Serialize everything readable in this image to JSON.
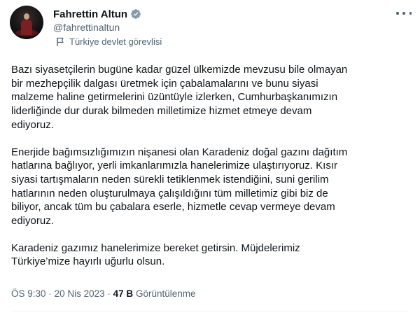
{
  "author": {
    "display_name": "Fahrettin Altun",
    "handle": "@fahrettinaltun",
    "verified_icon": "verified-badge-icon",
    "label": "Türkiye devlet görevlisi",
    "label_icon": "flag-icon",
    "verified_color": "#829aab"
  },
  "tweet": {
    "paragraphs": [
      "Bazı siyasetçilerin bugüne kadar güzel ülkemizde mevzusu bile olmayan\nbir mezhepçilik dalgası üretmek için çabalamalarını ve bunu siyasi\nmalzeme haline getirmelerini üzüntüyle izlerken, Cumhurbaşkanımızın\nliderliğinde dur durak bilmeden milletimize hizmet etmeye devam\nediyoruz.",
      "Enerjide bağımsızlığımızın nişanesi olan Karadeniz doğal gazını dağıtım\nhatlarına bağlıyor, yerli imkanlarımızla hanelerimize ulaştırıyoruz. Kısır\nsiyasi tartışmaların neden sürekli tetiklenmek istendiğini, suni gerilim\nhatlarının neden oluşturulmaya çalışıldığını tüm milletimiz gibi biz de\nbiliyor, ancak tüm bu çabalara eserle, hizmetle cevap vermeye devam\nediyoruz.",
      "Karadeniz gazımız hanelerimize bereket getirsin. Müjdelerimiz\nTürkiye’mize hayırlı uğurlu olsun."
    ],
    "time": "ÖS 9:30",
    "date": "20 Nis 2023",
    "separator": "·",
    "views_count": "47 B",
    "views_label": "Görüntülenme"
  },
  "actions": {
    "more_icon": "more-horizontal-icon"
  }
}
